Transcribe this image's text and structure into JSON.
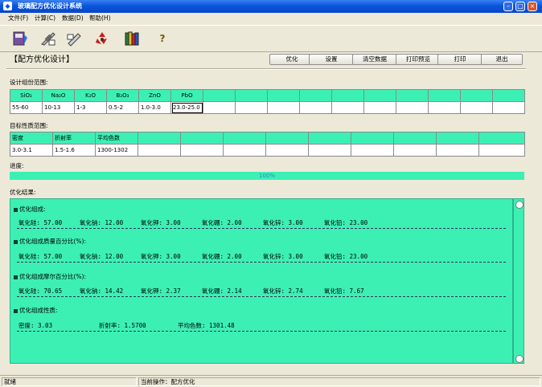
{
  "window": {
    "title": "玻璃配方优化设计系统"
  },
  "menu": [
    "文件(F)",
    "计算(C)",
    "数据(D)",
    "帮助(H)"
  ],
  "toolbar": {
    "icons": [
      "book-icon",
      "feather-icon",
      "quill-icon",
      "recycle-icon",
      "books-icon",
      "help-icon"
    ],
    "help_glyph": "?"
  },
  "page": {
    "heading": "【配方优化设计】"
  },
  "actions": {
    "optimize": "优化",
    "settings": "设置",
    "clear": "清空数据",
    "preview": "打印预览",
    "print": "打印",
    "exit": "退出"
  },
  "composition": {
    "label": "设计组份范围:",
    "headers": [
      "SiO₂",
      "Na₂O",
      "K₂O",
      "B₂O₃",
      "ZnO",
      "PbO"
    ],
    "values": [
      "55-60",
      "10-13",
      "1-3",
      "0.5-2",
      "1.0-3.0",
      "23.0-25.0"
    ]
  },
  "properties": {
    "label": "目标性质范围:",
    "headers": [
      "密度",
      "折射率",
      "平均色数"
    ],
    "values": [
      "3.0-3.1",
      "1.5-1.6",
      "1300-1302"
    ]
  },
  "progress": {
    "label": "进度:",
    "value": 100,
    "text": "100%"
  },
  "results": {
    "label": "优化结果:",
    "sections": [
      {
        "title": "优化组成:",
        "items": [
          "氧化硅: 57.00",
          "氧化钠: 12.00",
          "氧化钾: 3.00",
          "氧化硼: 2.00",
          "氧化锌: 3.00",
          "氧化铅: 23.00"
        ]
      },
      {
        "title": "优化组成质量百分比(%):",
        "items": [
          "氧化硅: 57.00",
          "氧化钠: 12.00",
          "氧化钾: 3.00",
          "氧化硼: 2.00",
          "氧化锌: 3.00",
          "氧化铅: 23.00"
        ]
      },
      {
        "title": "优化组成摩尔百分比(%):",
        "items": [
          "氧化硅: 70.65",
          "氧化钠: 14.42",
          "氧化钾: 2.37",
          "氧化硼: 2.14",
          "氧化锌: 2.74",
          "氧化铅: 7.67"
        ]
      },
      {
        "title": "优化组成性质:",
        "items": [
          "密度: 3.03",
          "折射率: 1.5700",
          "平均色数: 1301.48"
        ]
      }
    ]
  },
  "status": {
    "left": "就绪",
    "right": "当前操作：配方优化"
  },
  "colors": {
    "grid_header": "#3cf0b4",
    "titlebar": "#0a55dc",
    "progress_text": "#3a7be0"
  }
}
